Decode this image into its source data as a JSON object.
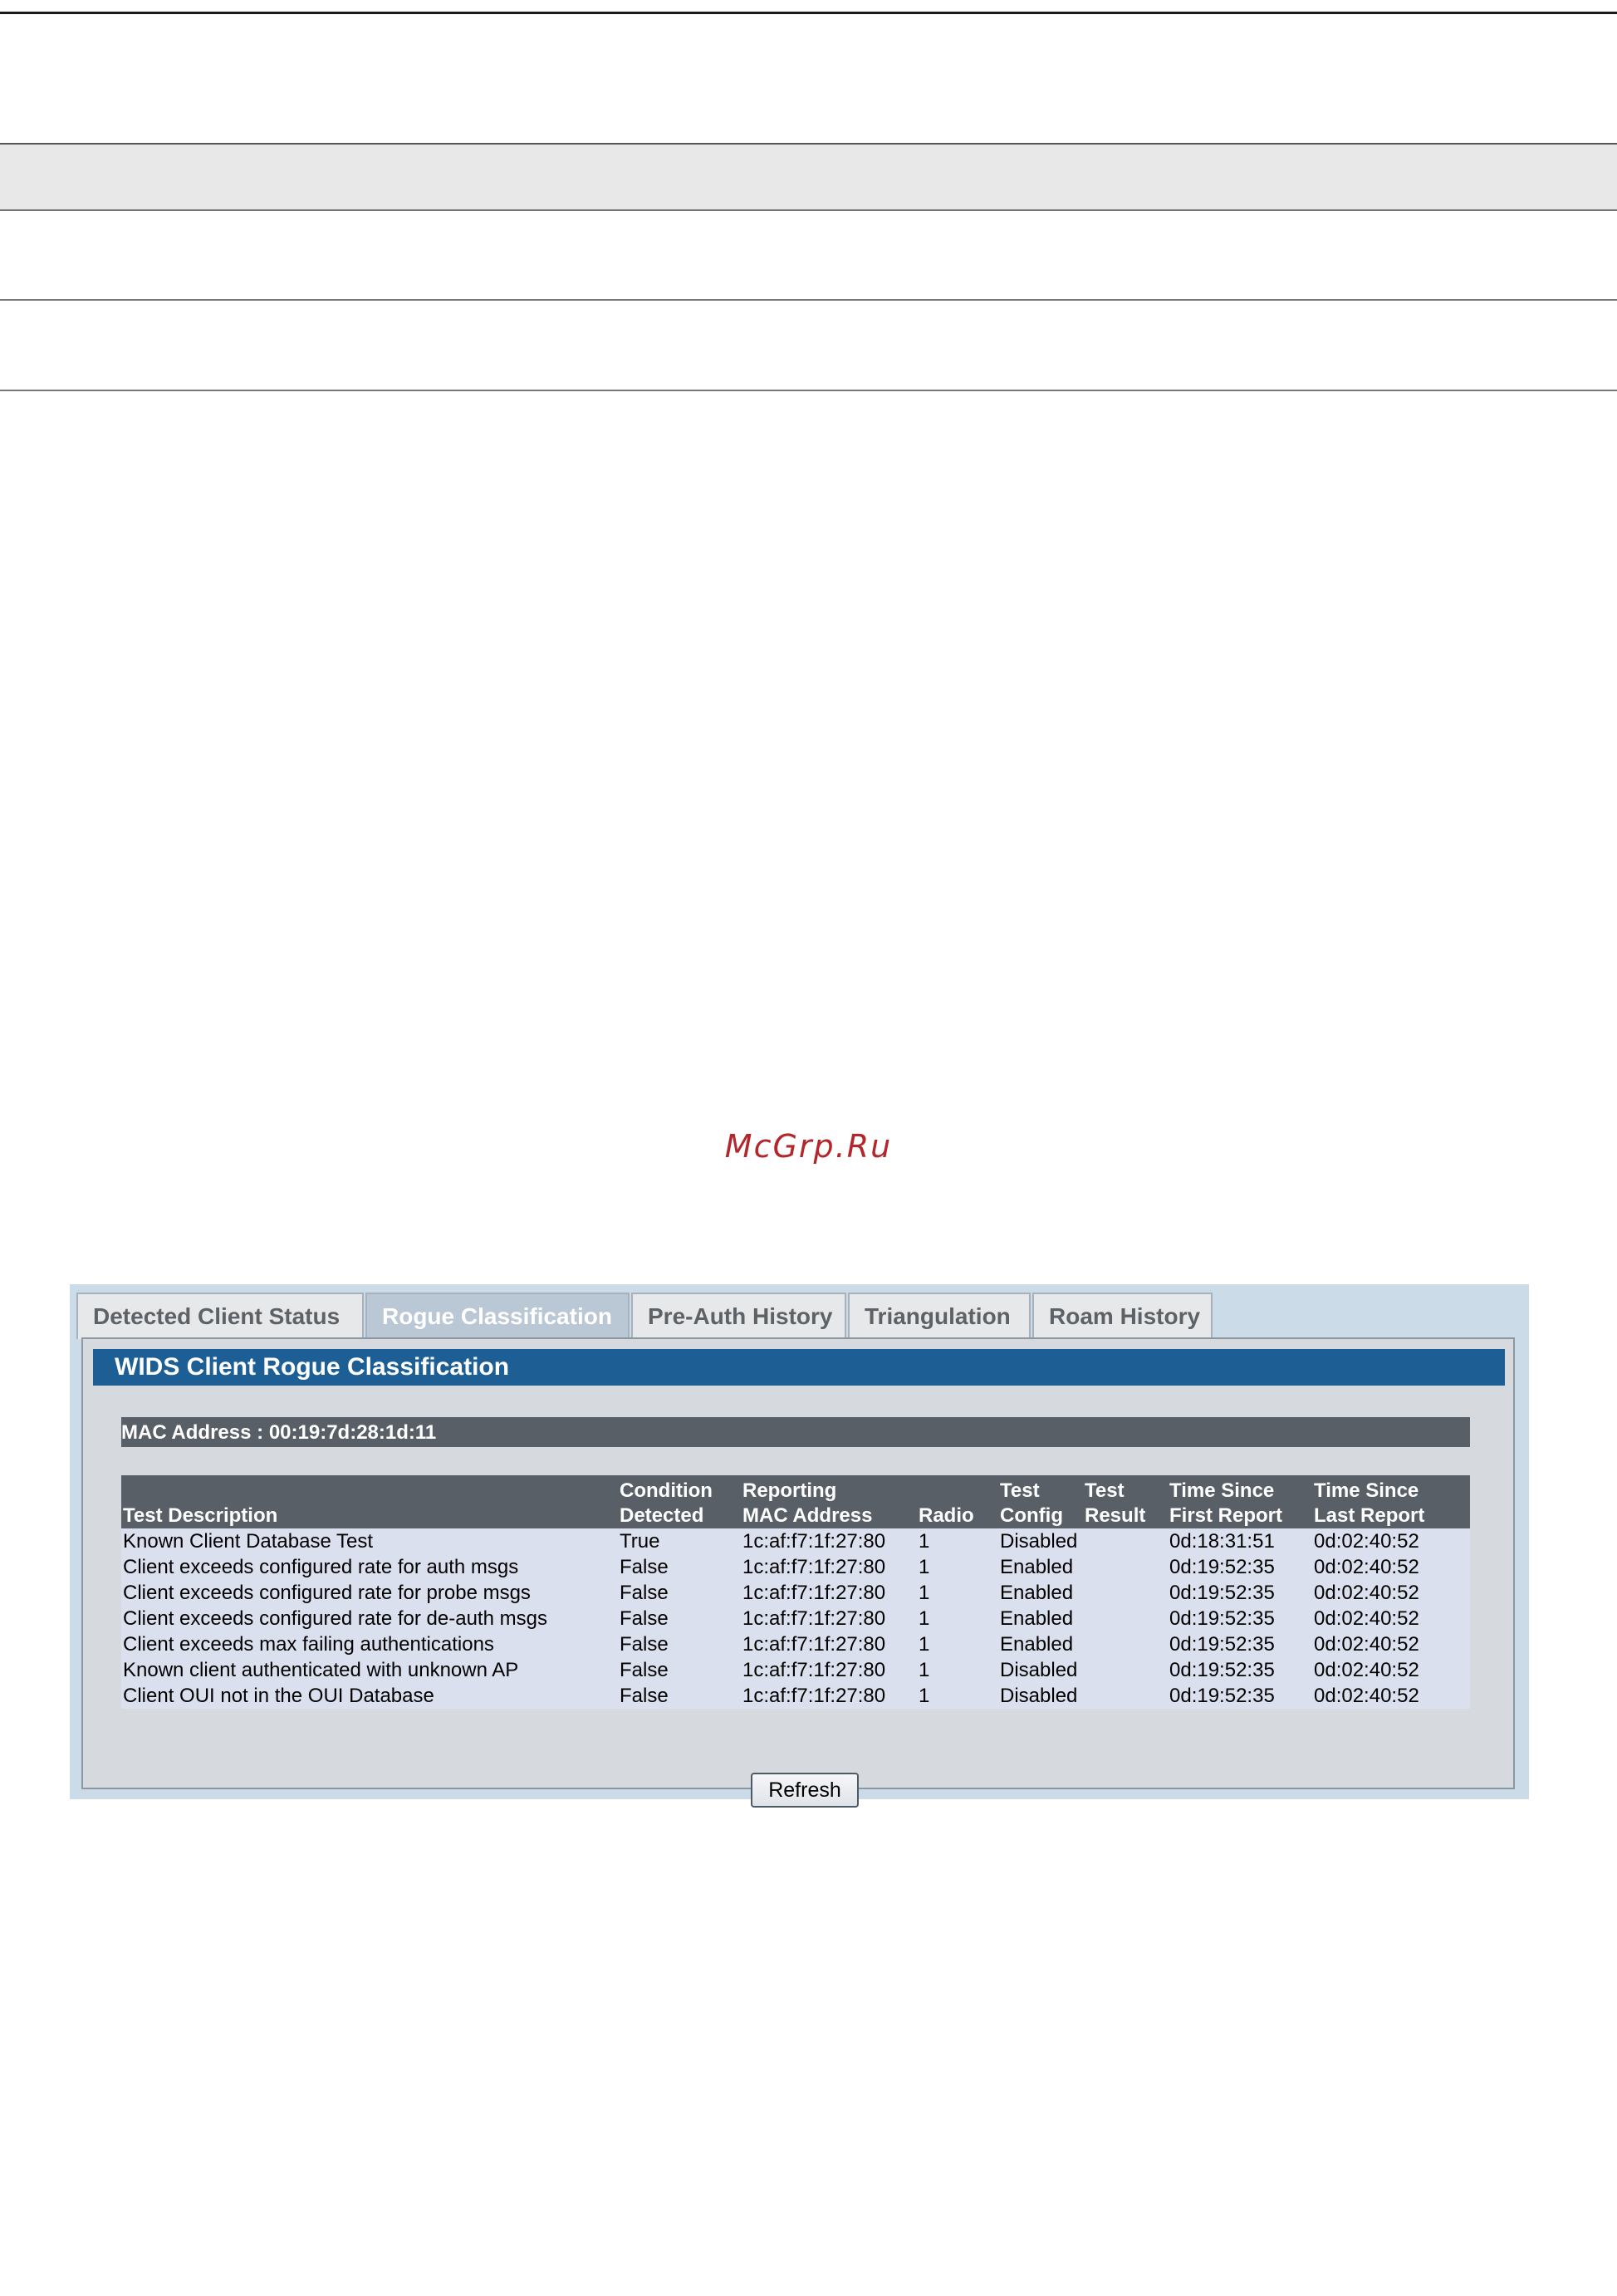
{
  "watermark": "McGrp.Ru",
  "tabs": [
    {
      "label": "Detected Client Status",
      "active": false
    },
    {
      "label": "Rogue Classification",
      "active": true
    },
    {
      "label": "Pre-Auth History",
      "active": false
    },
    {
      "label": "Triangulation",
      "active": false
    },
    {
      "label": "Roam History",
      "active": false
    }
  ],
  "panel": {
    "title": "WIDS Client Rogue Classification",
    "mac_label": "MAC Address :",
    "mac_value": "00:19:7d:28:1d:11"
  },
  "table": {
    "headers": [
      {
        "line1": "",
        "line2": "Test Description"
      },
      {
        "line1": "Condition",
        "line2": "Detected"
      },
      {
        "line1": "Reporting",
        "line2": "MAC Address"
      },
      {
        "line1": "",
        "line2": "Radio"
      },
      {
        "line1": "Test",
        "line2": "Config"
      },
      {
        "line1": "Test",
        "line2": "Result"
      },
      {
        "line1": "Time Since",
        "line2": "First Report"
      },
      {
        "line1": "Time Since",
        "line2": "Last Report"
      }
    ],
    "rows": [
      [
        "Known Client Database Test",
        "True",
        "1c:af:f7:1f:27:80",
        "1",
        "Disabled",
        "",
        "0d:18:31:51",
        "0d:02:40:52"
      ],
      [
        "Client exceeds configured rate for auth msgs",
        "False",
        "1c:af:f7:1f:27:80",
        "1",
        "Enabled",
        "",
        "0d:19:52:35",
        "0d:02:40:52"
      ],
      [
        "Client exceeds configured rate for probe msgs",
        "False",
        "1c:af:f7:1f:27:80",
        "1",
        "Enabled",
        "",
        "0d:19:52:35",
        "0d:02:40:52"
      ],
      [
        "Client exceeds configured rate for de-auth msgs",
        "False",
        "1c:af:f7:1f:27:80",
        "1",
        "Enabled",
        "",
        "0d:19:52:35",
        "0d:02:40:52"
      ],
      [
        "Client exceeds max failing authentications",
        "False",
        "1c:af:f7:1f:27:80",
        "1",
        "Enabled",
        "",
        "0d:19:52:35",
        "0d:02:40:52"
      ],
      [
        "Known client authenticated with unknown AP",
        "False",
        "1c:af:f7:1f:27:80",
        "1",
        "Disabled",
        "",
        "0d:19:52:35",
        "0d:02:40:52"
      ],
      [
        "Client OUI not in the OUI Database",
        "False",
        "1c:af:f7:1f:27:80",
        "1",
        "Disabled",
        "",
        "0d:19:52:35",
        "0d:02:40:52"
      ]
    ]
  },
  "refresh_label": "Refresh"
}
